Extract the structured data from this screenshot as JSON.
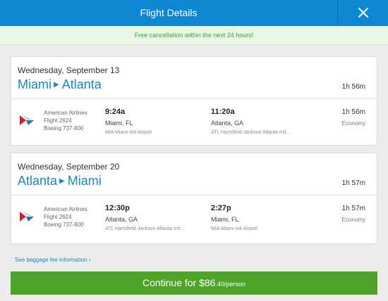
{
  "header": {
    "title": "Flight Details",
    "close_icon": "close-icon"
  },
  "notice": "Free cancellation within the next 24 hours!",
  "trips": [
    {
      "date": "Wednesday, September 13",
      "origin": "Miami",
      "destination": "Atlanta",
      "duration": "1h 56m",
      "segment": {
        "airline": "American Airlines",
        "flight": "Flight 2624",
        "aircraft": "Boeing 737-800",
        "depart_time": "9:24a",
        "depart_city": "Miami, FL",
        "depart_airport": "MIA Miami Intl Airport",
        "arrive_time": "11:20a",
        "arrive_city": "Atlanta, GA",
        "arrive_airport": "ATL Hartsfield-Jackson Atlanta Intl...",
        "duration": "1h 56m",
        "cabin": "Economy"
      }
    },
    {
      "date": "Wednesday, September 20",
      "origin": "Atlanta",
      "destination": "Miami",
      "duration": "1h 57m",
      "segment": {
        "airline": "American Airlines",
        "flight": "Flight 2624",
        "aircraft": "Boeing 737-800",
        "depart_time": "12:30p",
        "depart_city": "Atlanta, GA",
        "depart_airport": "ATL Hartsfield-Jackson Atlanta Intl...",
        "arrive_time": "2:27p",
        "arrive_city": "Miami, FL",
        "arrive_airport": "MIA Miami Intl Airport",
        "duration": "1h 57m",
        "cabin": "Economy"
      }
    }
  ],
  "baggage_link": "See baggage fee information",
  "continue": {
    "prefix": "Continue for $86",
    "cents": ".40",
    "suffix": "/person"
  },
  "colors": {
    "header": "#0f86d2",
    "accent": "#1a87c8",
    "success": "#4ea329",
    "notice_text": "#3aa533"
  }
}
